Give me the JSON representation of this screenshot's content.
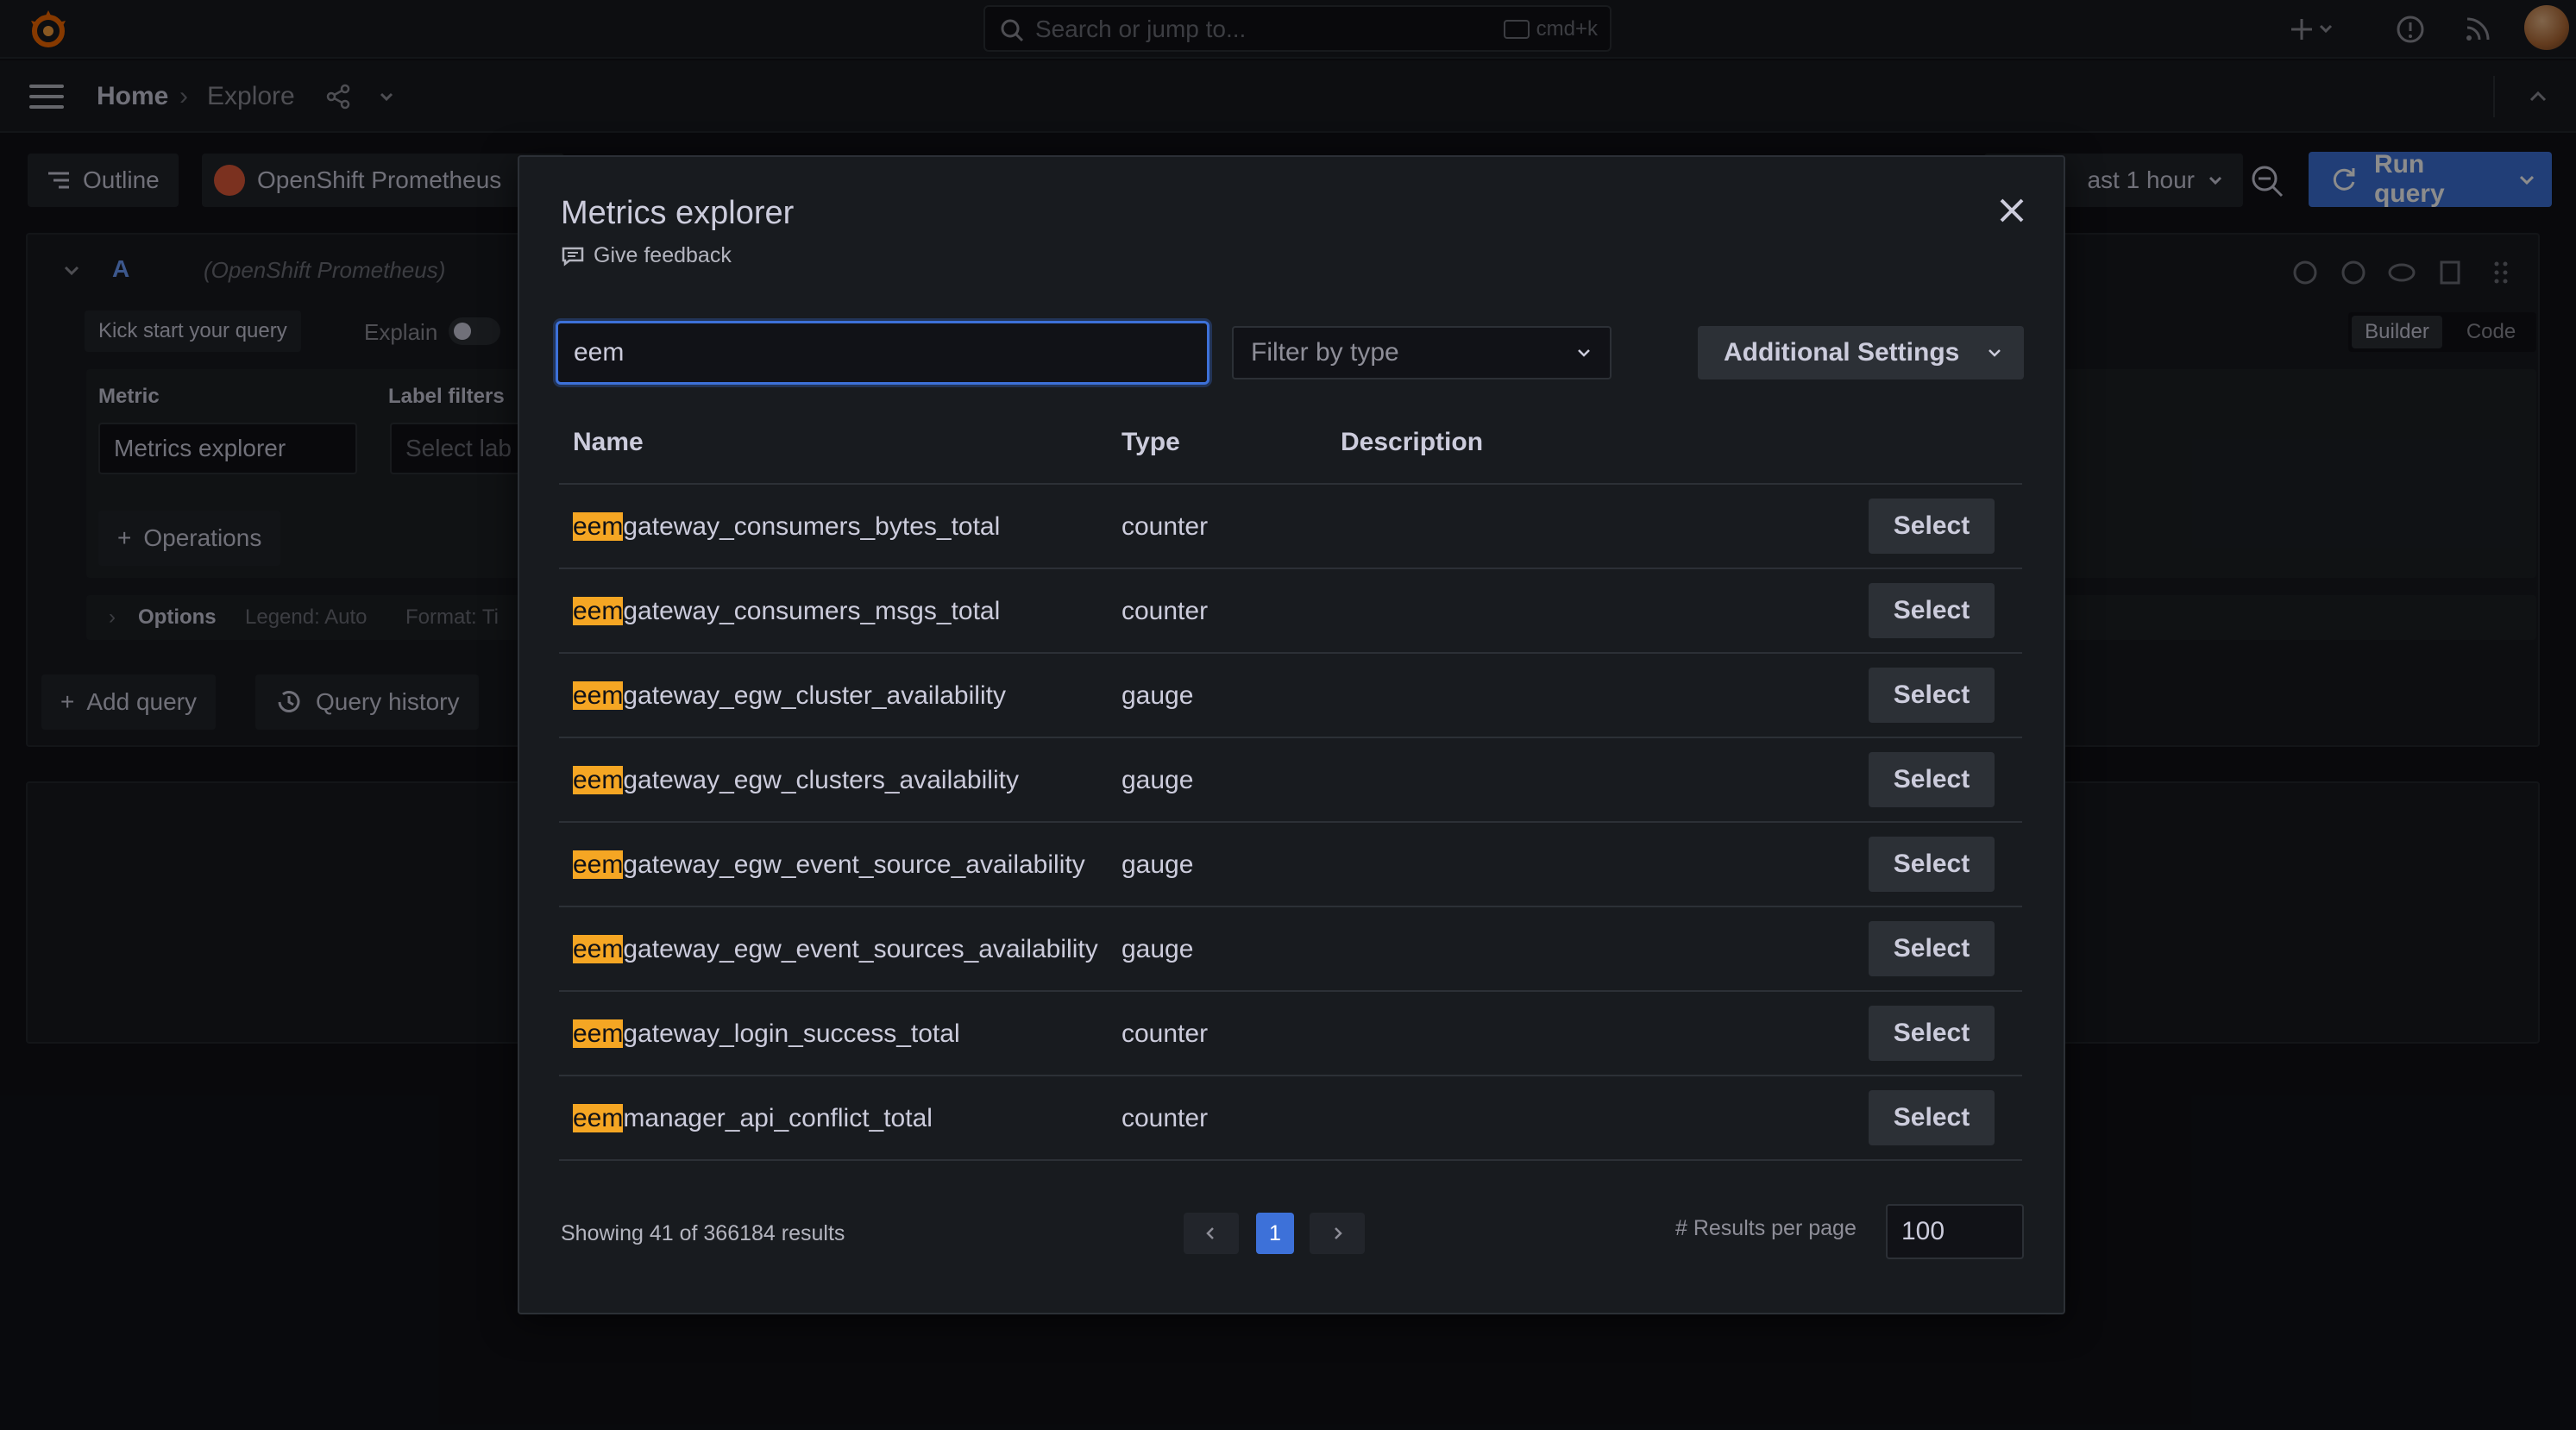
{
  "topbar": {
    "search_placeholder": "Search or jump to...",
    "search_shortcut": "cmd+k"
  },
  "breadcrumb": {
    "home": "Home",
    "separator": "›",
    "current": "Explore"
  },
  "explore": {
    "outline_label": "Outline",
    "datasource_label": "OpenShift Prometheus",
    "time_range_label": "ast 1 hour",
    "run_query_label": "Run query",
    "query_letter": "A",
    "query_datasource": "(OpenShift Prometheus)",
    "kick_start_label": "Kick start your query",
    "explain_label": "Explain",
    "builder_label": "Builder",
    "code_label": "Code",
    "metric_label": "Metric",
    "label_filters_label": "Label filters",
    "metric_select_value": "Metrics explorer",
    "label_select_placeholder": "Select lab",
    "operations_label": "Operations",
    "options_label": "Options",
    "legend_text": "Legend: Auto",
    "format_text": "Format: Ti",
    "add_query_label": "Add query",
    "query_history_label": "Query history"
  },
  "modal": {
    "title": "Metrics explorer",
    "feedback_label": "Give feedback",
    "search_value": "eem",
    "filter_type_placeholder": "Filter by type",
    "additional_settings_label": "Additional Settings",
    "columns": {
      "name": "Name",
      "type": "Type",
      "description": "Description"
    },
    "highlight_prefix": "eem",
    "select_label": "Select",
    "rows": [
      {
        "prefix": "eem",
        "rest": "gateway_consumers_bytes_total",
        "type": "counter"
      },
      {
        "prefix": "eem",
        "rest": "gateway_consumers_msgs_total",
        "type": "counter"
      },
      {
        "prefix": "eem",
        "rest": "gateway_egw_cluster_availability",
        "type": "gauge"
      },
      {
        "prefix": "eem",
        "rest": "gateway_egw_clusters_availability",
        "type": "gauge"
      },
      {
        "prefix": "eem",
        "rest": "gateway_egw_event_source_availability",
        "type": "gauge"
      },
      {
        "prefix": "eem",
        "rest": "gateway_egw_event_sources_availability",
        "type": "gauge"
      },
      {
        "prefix": "eem",
        "rest": "gateway_login_success_total",
        "type": "counter"
      },
      {
        "prefix": "eem",
        "rest": "manager_api_conflict_total",
        "type": "counter"
      }
    ],
    "results_text": "Showing 41 of 366184 results",
    "current_page": "1",
    "results_per_page_label": "# Results per page",
    "results_per_page_value": "100"
  },
  "colors": {
    "accent": "#3d71d9",
    "highlight": "#f5a623",
    "panel": "#181b1f",
    "background": "#111217"
  }
}
